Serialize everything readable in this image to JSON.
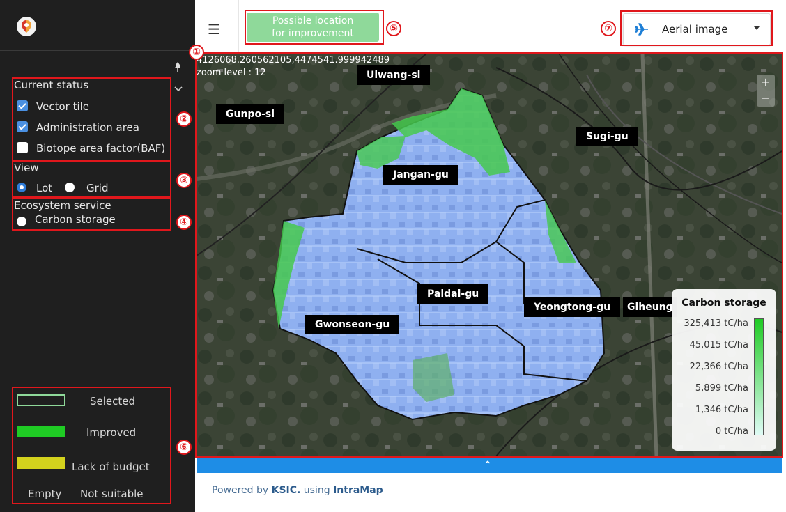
{
  "sidebar": {
    "current_status_title": "Current status",
    "layers": [
      {
        "label": "Vector tile",
        "checked": true
      },
      {
        "label": "Administration area",
        "checked": true
      },
      {
        "label": "Biotope area factor(BAF)",
        "checked": false
      }
    ],
    "view_title": "View",
    "view_options": [
      {
        "label": "Lot",
        "selected": true
      },
      {
        "label": "Grid",
        "selected": false
      }
    ],
    "ecosystem_title": "Ecosystem service",
    "ecosystem_option": "Carbon storage",
    "legend": {
      "selected": "Selected",
      "improved": "Improved",
      "lack_of_budget": "Lack of budget",
      "empty": "Empty",
      "not_suitable": "Not suitable"
    }
  },
  "header": {
    "menu_icon": "☰",
    "improve_button": {
      "line1": "Possible location",
      "line2": "for improvement"
    },
    "basemap_select": {
      "value": "Aerial image",
      "icon": "airplane-icon"
    }
  },
  "annotations": [
    "①",
    "②",
    "③",
    "④",
    "⑤",
    "⑥",
    "⑦"
  ],
  "map": {
    "coordinates": "4126068.260562105,4474541.999942489",
    "zoom_text": "zoom level : 12",
    "zoom_in": "+",
    "zoom_out": "−",
    "labels": {
      "uiwang": "Uiwang-si",
      "gunpo": "Gunpo-si",
      "sugi": "Sugi-gu",
      "jangan": "Jangan-gu",
      "paldal": "Paldal-gu",
      "yeongtong": "Yeongtong-gu",
      "giheung": "Giheung",
      "gwonseon": "Gwonseon-gu"
    },
    "carbon_legend": {
      "title": "Carbon storage",
      "values": [
        "325,413 tC/ha",
        "45,015 tC/ha",
        "22,366 tC/ha",
        "5,899 tC/ha",
        "1,346 tC/ha",
        "0 tC/ha"
      ]
    }
  },
  "collapse_arrow": "⌃",
  "footer": {
    "powered": "Powered by",
    "ksic": "KSIC.",
    "using": "using",
    "intramap": "IntraMap"
  },
  "colors": {
    "annotation": "#e0171c",
    "improve_button": "#8fd99a",
    "city_fill": "#8fb0f0",
    "green_fill": "#3fcf4a",
    "bar_blue": "#1e8de6"
  }
}
